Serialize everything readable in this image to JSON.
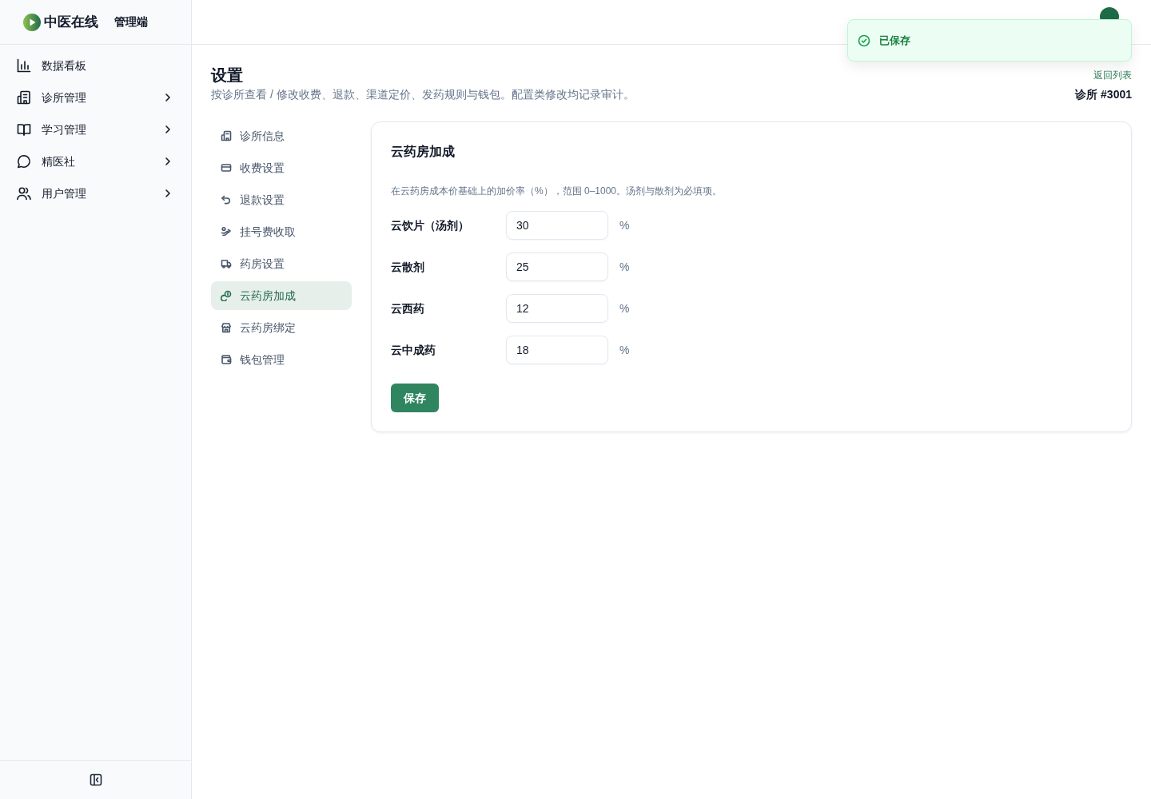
{
  "sidebar": {
    "brand": {
      "name": "中医在线",
      "suffix": "管理端"
    },
    "items": [
      {
        "label": "数据看板",
        "submenu": false
      },
      {
        "label": "诊所管理",
        "submenu": true
      },
      {
        "label": "学习管理",
        "submenu": true
      },
      {
        "label": "精医社",
        "submenu": true
      },
      {
        "label": "用户管理",
        "submenu": true
      }
    ]
  },
  "toast": {
    "text": "已保存"
  },
  "page": {
    "title": "设置",
    "subtitle": "按诊所查看 / 修改收费、退款、渠道定价、发药规则与钱包。配置类修改均记录审计。",
    "back_link": "返回列表",
    "clinic": "诊所 #3001"
  },
  "settings_nav": [
    {
      "label": "诊所信息",
      "selected": false
    },
    {
      "label": "收费设置",
      "selected": false
    },
    {
      "label": "退款设置",
      "selected": false
    },
    {
      "label": "挂号费收取",
      "selected": false
    },
    {
      "label": "药房设置",
      "selected": false
    },
    {
      "label": "云药房加成",
      "selected": true
    },
    {
      "label": "云药房绑定",
      "selected": false
    },
    {
      "label": "钱包管理",
      "selected": false
    }
  ],
  "card": {
    "title": "云药房加成",
    "description": "在云药房成本价基础上的加价率（%），范围 0–1000。汤剂与散剂为必填项。",
    "fields": [
      {
        "label": "云饮片（汤剂）",
        "value": "30",
        "unit": "%"
      },
      {
        "label": "云散剂",
        "value": "25",
        "unit": "%"
      },
      {
        "label": "云西药",
        "value": "12",
        "unit": "%"
      },
      {
        "label": "云中成药",
        "value": "18",
        "unit": "%"
      }
    ],
    "save_button": "保存"
  }
}
